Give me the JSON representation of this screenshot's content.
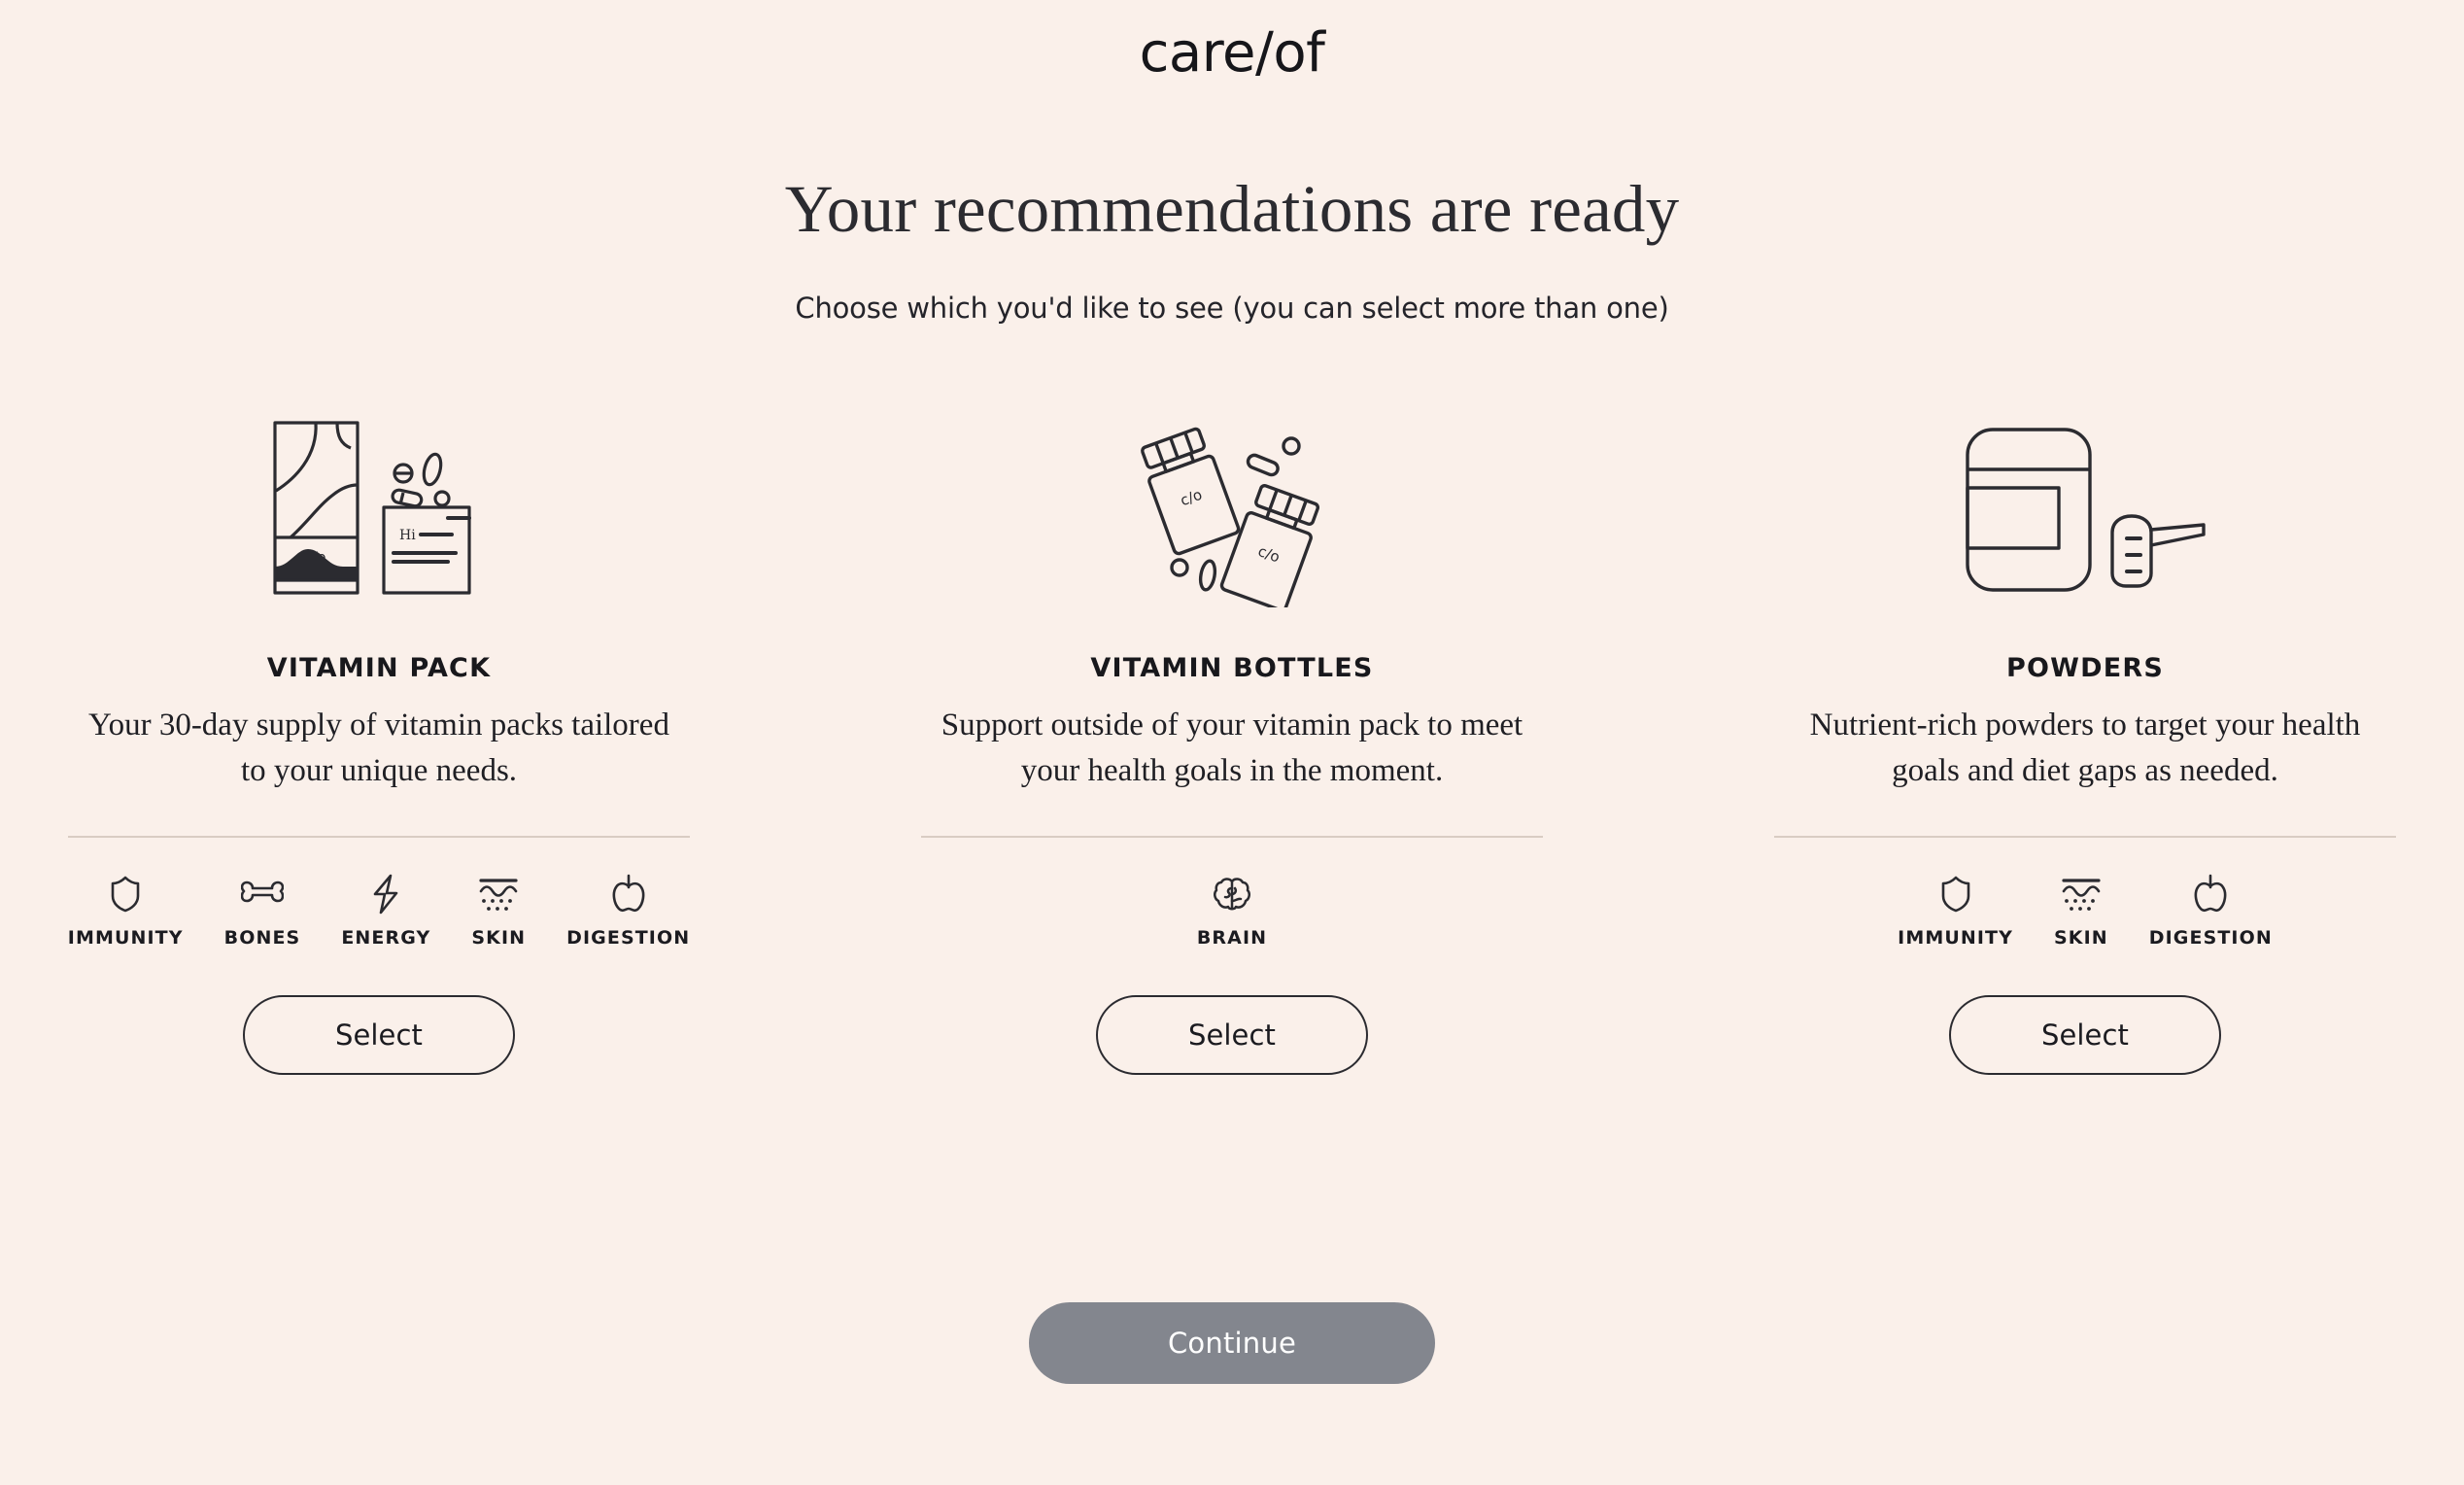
{
  "brand": {
    "logo": "care/of"
  },
  "header": {
    "headline": "Your recommendations are ready",
    "subhead": "Choose which you'd like to see (you can select more than one)"
  },
  "cards": [
    {
      "id": "vitamin-pack",
      "art_icon": "vitamin-pack-illustration",
      "title": "VITAMIN PACK",
      "description": "Your 30-day supply of vitamin packs tailored to your unique needs.",
      "select_label": "Select",
      "tags": [
        {
          "icon": "shield-icon",
          "label": "IMMUNITY"
        },
        {
          "icon": "bone-icon",
          "label": "BONES"
        },
        {
          "icon": "lightning-bolt-icon",
          "label": "ENERGY"
        },
        {
          "icon": "skin-waves-icon",
          "label": "SKIN"
        },
        {
          "icon": "apple-icon",
          "label": "DIGESTION"
        }
      ]
    },
    {
      "id": "vitamin-bottles",
      "art_icon": "vitamin-bottles-illustration",
      "title": "VITAMIN BOTTLES",
      "description": "Support outside of your vitamin pack to meet your health goals in the moment.",
      "select_label": "Select",
      "tags": [
        {
          "icon": "brain-icon",
          "label": "BRAIN"
        }
      ]
    },
    {
      "id": "powders",
      "art_icon": "powders-illustration",
      "title": "POWDERS",
      "description": "Nutrient-rich powders to target your health goals and diet gaps as needed.",
      "select_label": "Select",
      "tags": [
        {
          "icon": "shield-icon",
          "label": "IMMUNITY"
        },
        {
          "icon": "skin-waves-icon",
          "label": "SKIN"
        },
        {
          "icon": "apple-icon",
          "label": "DIGESTION"
        }
      ]
    }
  ],
  "footer": {
    "continue_label": "Continue"
  },
  "colors": {
    "background": "#faf0ea",
    "ink": "#2b2b30",
    "divider": "#d9ccc3",
    "continue_button": "#83868e",
    "continue_text": "#ffffff"
  },
  "illustration_text": {
    "pack_brand": "c/o",
    "card_greeting": "Hi",
    "bottle_brand": "c/o"
  }
}
